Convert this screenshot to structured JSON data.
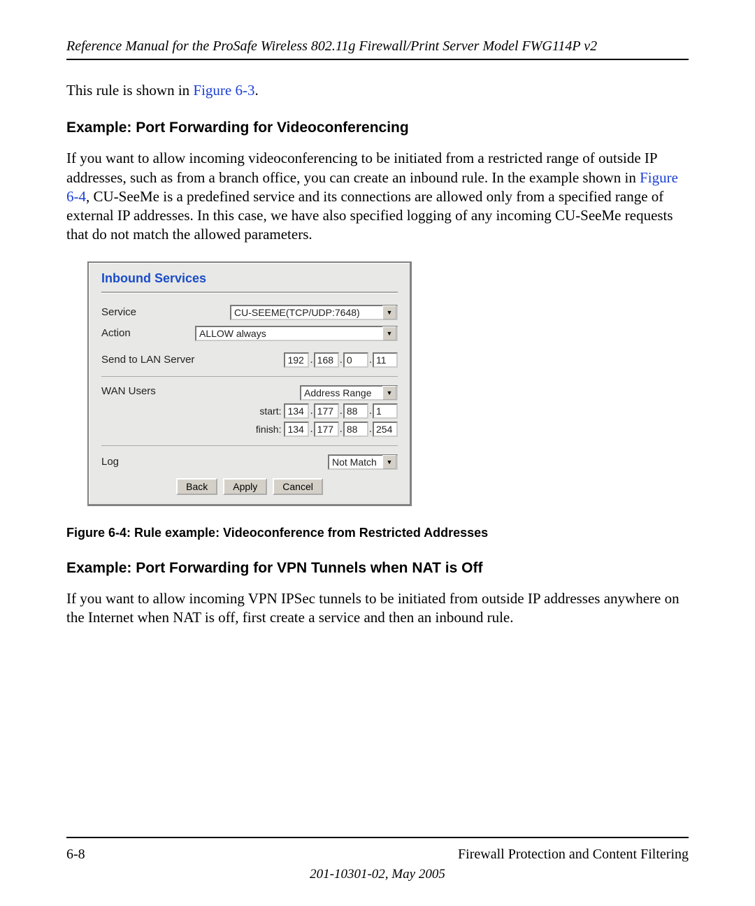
{
  "header": {
    "title": "Reference Manual for the ProSafe Wireless 802.11g  Firewall/Print Server Model FWG114P v2"
  },
  "para1": {
    "prefix": "This rule is shown in ",
    "link": "Figure 6-3",
    "suffix": "."
  },
  "heading1": "Example: Port Forwarding for Videoconferencing",
  "para2": {
    "part1": "If you want to allow incoming videoconferencing to be initiated from a restricted range of outside IP addresses, such as from a branch office, you can create an inbound rule. In the example shown in ",
    "link": "Figure 6-4",
    "part2": ", CU-SeeMe is a predefined service and its connections are allowed only from a specified range of external IP addresses. In this case, we have also specified logging of any incoming CU-SeeMe requests that do not match the allowed parameters."
  },
  "panel": {
    "title": "Inbound Services",
    "labels": {
      "service": "Service",
      "action": "Action",
      "sendTo": "Send to LAN Server",
      "wanUsers": "WAN Users",
      "log": "Log",
      "start": "start:",
      "finish": "finish:"
    },
    "values": {
      "service": "CU-SEEME(TCP/UDP:7648)",
      "action": "ALLOW always",
      "wanUsers": "Address Range",
      "log": "Not Match"
    },
    "ip": {
      "lan": [
        "192",
        "168",
        "0",
        "11"
      ],
      "start": [
        "134",
        "177",
        "88",
        "1"
      ],
      "finish": [
        "134",
        "177",
        "88",
        "254"
      ]
    },
    "buttons": {
      "back": "Back",
      "apply": "Apply",
      "cancel": "Cancel"
    }
  },
  "figureCaption": "Figure 6-4:  Rule example: Videoconference from Restricted Addresses",
  "heading2": "Example: Port Forwarding for VPN Tunnels when NAT is Off",
  "para3": "If you want to allow incoming VPN IPSec tunnels to be initiated from outside IP addresses anywhere on the Internet when NAT is off, first create a service and then an inbound rule.",
  "footer": {
    "pageNum": "6-8",
    "sectionTitle": "Firewall Protection and Content Filtering",
    "docNum": "201-10301-02, May 2005"
  }
}
